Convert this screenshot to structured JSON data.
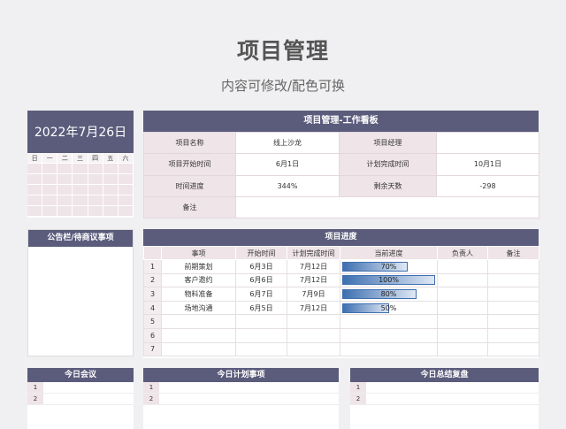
{
  "page": {
    "title": "项目管理",
    "subtitle": "内容可修改/配色可换"
  },
  "calendar": {
    "date": "2022年7月26日",
    "weekdays": [
      "日",
      "一",
      "二",
      "三",
      "四",
      "五",
      "六"
    ]
  },
  "board": {
    "title": "项目管理-工作看板",
    "project_name_label": "项目名称",
    "project_name": "线上沙龙",
    "manager_label": "项目经理",
    "manager": "",
    "start_label": "项目开始时间",
    "start": "6月1日",
    "plan_end_label": "计划完成时间",
    "plan_end": "10月1日",
    "progress_label": "时间进度",
    "progress": "344%",
    "remaining_label": "剩余天数",
    "remaining": "-298",
    "note_label": "备注",
    "note": ""
  },
  "notice": {
    "title": "公告栏/待商议事项"
  },
  "progress_table": {
    "title": "项目进度",
    "headers": [
      "事项",
      "开始时间",
      "计划完成时间",
      "当前进度",
      "负责人",
      "备注"
    ],
    "rows": [
      {
        "n": "1",
        "item": "前期策划",
        "start": "6月3日",
        "end": "7月12日",
        "pct": "70%",
        "pct_value": 0.7,
        "owner": "",
        "note": ""
      },
      {
        "n": "2",
        "item": "客户邀约",
        "start": "6月6日",
        "end": "7月12日",
        "pct": "100%",
        "pct_value": 1.0,
        "owner": "",
        "note": ""
      },
      {
        "n": "3",
        "item": "物料准备",
        "start": "6月7日",
        "end": "7月9日",
        "pct": "80%",
        "pct_value": 0.8,
        "owner": "",
        "note": ""
      },
      {
        "n": "4",
        "item": "场地沟通",
        "start": "6月5日",
        "end": "7月12日",
        "pct": "50%",
        "pct_value": 0.5,
        "owner": "",
        "note": ""
      },
      {
        "n": "5",
        "item": "",
        "start": "",
        "end": "",
        "pct": "",
        "pct_value": 0,
        "owner": "",
        "note": ""
      },
      {
        "n": "6",
        "item": "",
        "start": "",
        "end": "",
        "pct": "",
        "pct_value": 0,
        "owner": "",
        "note": ""
      },
      {
        "n": "7",
        "item": "",
        "start": "",
        "end": "",
        "pct": "",
        "pct_value": 0,
        "owner": "",
        "note": ""
      }
    ]
  },
  "bottom": {
    "meeting_title": "今日会议",
    "plan_title": "今日计划事项",
    "summary_title": "今日总结复盘",
    "row_numbers": [
      "1",
      "2"
    ]
  }
}
